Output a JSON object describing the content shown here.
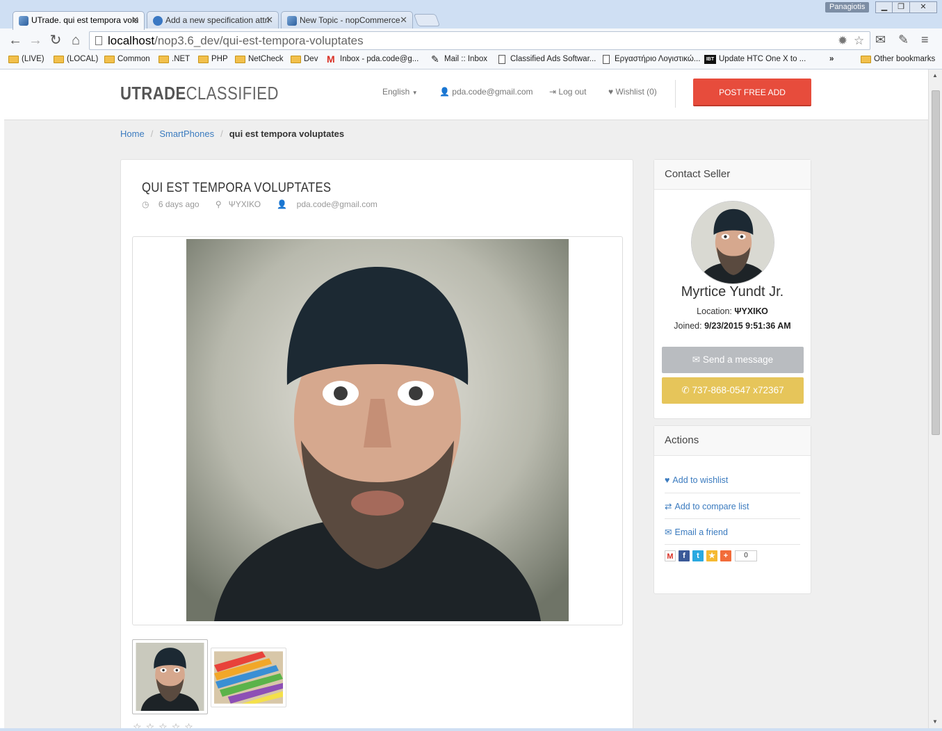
{
  "browser": {
    "tabs": [
      {
        "title": "UTrade. qui est tempora volu",
        "active": true
      },
      {
        "title": "Add a new specification attri",
        "active": false
      },
      {
        "title": "New Topic - nopCommerce",
        "active": false
      }
    ],
    "user": "Panagiotis",
    "url_host": "localhost",
    "url_path": "/nop3.6_dev/qui-est-tempora-voluptates",
    "bookmarks": [
      {
        "label": "(LIVE)",
        "icon": "folder-icon"
      },
      {
        "label": "(LOCAL)",
        "icon": "folder-icon"
      },
      {
        "label": "Common",
        "icon": "folder-icon"
      },
      {
        "label": ".NET",
        "icon": "folder-icon"
      },
      {
        "label": "PHP",
        "icon": "folder-icon"
      },
      {
        "label": "NetCheck",
        "icon": "folder-icon"
      },
      {
        "label": "Dev",
        "icon": "folder-icon"
      },
      {
        "label": "Inbox - pda.code@g...",
        "icon": "gmail-icon"
      },
      {
        "label": "Mail :: Inbox",
        "icon": "mail-icon"
      },
      {
        "label": "Classified Ads Softwar...",
        "icon": "page-icon"
      },
      {
        "label": "Εργαστήριο Λογιστικώ...",
        "icon": "page-icon"
      },
      {
        "label": "Update HTC One X to ...",
        "icon": "ibt-icon"
      }
    ],
    "bookmarks_overflow": "»",
    "other_bookmarks": "Other bookmarks",
    "ibt_logo_text": "IBT"
  },
  "header": {
    "logo_bold": "UTRADE",
    "logo_light": "CLASSIFIED",
    "language": "English",
    "email": "pda.code@gmail.com",
    "logout": "Log out",
    "wishlist": "Wishlist (0)",
    "post_button": "POST FREE ADD"
  },
  "breadcrumb": {
    "home": "Home",
    "category": "SmartPhones",
    "current": "qui est tempora voluptates"
  },
  "product": {
    "title": "QUI EST TEMPORA VOLUPTATES",
    "posted": "6 days ago",
    "location": "ΨΥΧΙΚΟ",
    "seller_email": "pda.code@gmail.com",
    "rating_stars": 5
  },
  "contact": {
    "heading": "Contact Seller",
    "name": "Myrtice Yundt Jr.",
    "location_label": "Location:",
    "location_value": "ΨΥΧΙΚΟ",
    "joined_label": "Joined:",
    "joined_value": "9/23/2015 9:51:36 AM",
    "message_button": "Send a message",
    "phone_button": "737-868-0547 x72367"
  },
  "actions": {
    "heading": "Actions",
    "items": [
      {
        "label": "Add to wishlist",
        "icon": "heart-icon"
      },
      {
        "label": "Add to compare list",
        "icon": "compare-icon"
      },
      {
        "label": "Email a friend",
        "icon": "envelope-icon"
      }
    ],
    "share_count": "0"
  },
  "colors": {
    "accent_red": "#e74c3c",
    "link_blue": "#3b7bbf",
    "phone_yellow": "#e6c55a",
    "message_gray": "#b9bcc0"
  }
}
